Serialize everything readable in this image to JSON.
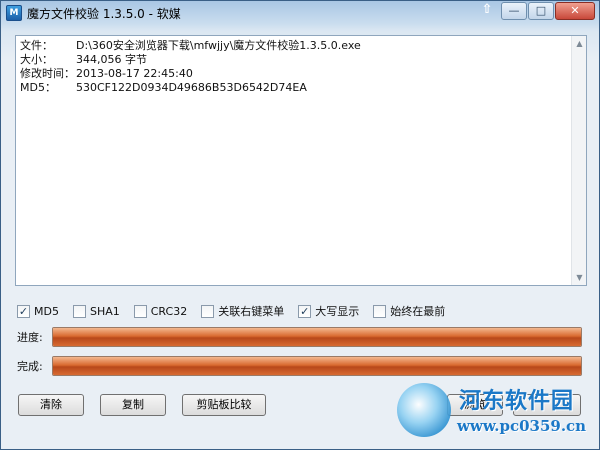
{
  "window": {
    "title": "魔方文件校验 1.3.5.0 - 软媒",
    "app_icon_text": "M",
    "controls": {
      "pin": "⇧",
      "minimize": "—",
      "maximize": "□",
      "close": "✕"
    }
  },
  "file_info": {
    "lines": [
      {
        "label": "文件：",
        "value": "D:\\360安全浏览器下载\\mfwjjy\\魔方文件校验1.3.5.0.exe"
      },
      {
        "label": "大小：",
        "value": "344,056 字节"
      },
      {
        "label": "修改时间：",
        "value": "2013-08-17 22:45:40"
      },
      {
        "label": "MD5：",
        "value": "530CF122D0934D49686B53D6542D74EA"
      }
    ]
  },
  "options": [
    {
      "label": "MD5",
      "checked": true
    },
    {
      "label": "SHA1",
      "checked": false
    },
    {
      "label": "CRC32",
      "checked": false
    },
    {
      "label": "关联右键菜单",
      "checked": false
    },
    {
      "label": "大写显示",
      "checked": true
    },
    {
      "label": "始终在最前",
      "checked": false
    }
  ],
  "progress": {
    "label": "进度:",
    "value": 1.0
  },
  "complete": {
    "label": "完成:",
    "value": 1.0
  },
  "buttons": {
    "clear": "清除",
    "copy": "复制",
    "clipboard_compare": "剪贴板比较",
    "browse": "浏览"
  },
  "watermark": {
    "title": "河东软件园",
    "url": "www.pc0359.cn"
  },
  "colors": {
    "progress_fill": "#c8541f",
    "title_bar": "#a9c6e4"
  }
}
